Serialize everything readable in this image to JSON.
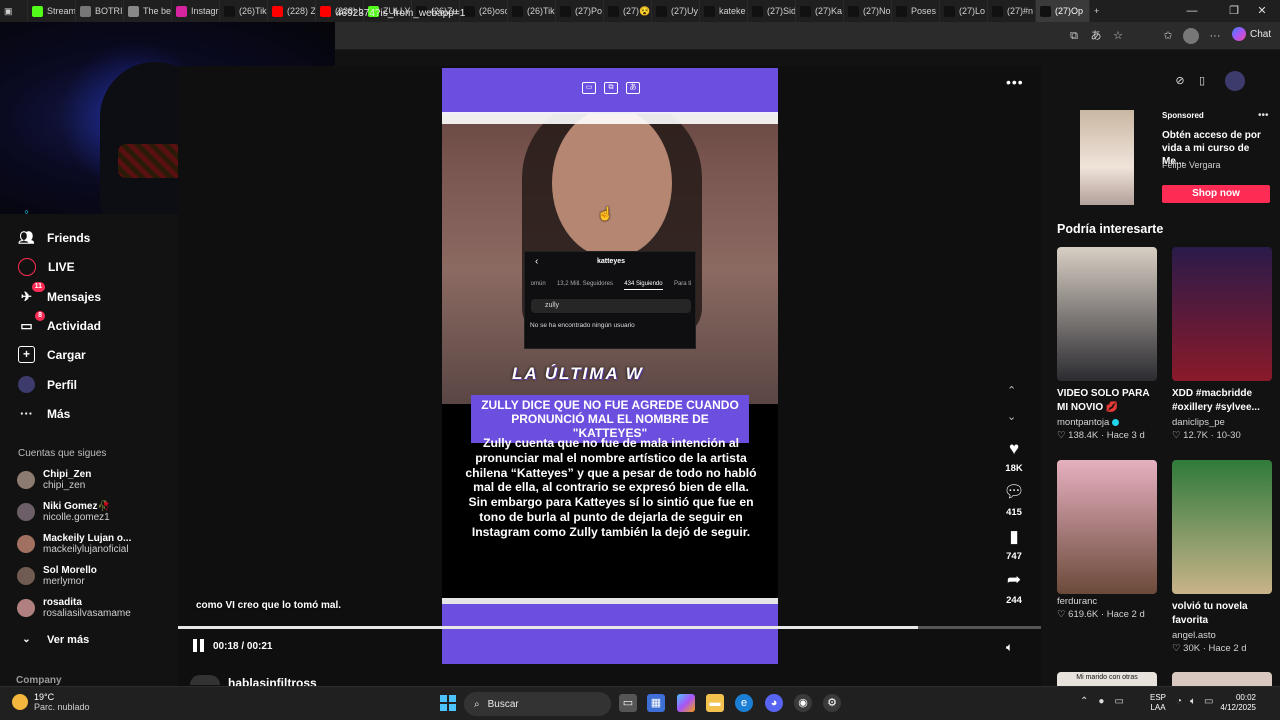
{
  "browser": {
    "tabs": [
      {
        "label": "Stream",
        "icon": "kick-icon",
        "color": "#53fc18"
      },
      {
        "label": "BOTRIX",
        "icon": "botrix-icon",
        "color": "#777777"
      },
      {
        "label": "The be",
        "icon": "diamond-icon",
        "color": "#888888"
      },
      {
        "label": "Instagr",
        "icon": "instagram-icon",
        "color": "#d6249f"
      },
      {
        "label": "(26)Tik",
        "icon": "tiktok-icon",
        "color": "#111111"
      },
      {
        "label": "(228) Z",
        "icon": "youtube-icon",
        "color": "#ff0000"
      },
      {
        "label": "(228) L",
        "icon": "youtube-icon",
        "color": "#ff0000"
      },
      {
        "label": "ZULLY",
        "icon": "kick-icon",
        "color": "#53fc18"
      },
      {
        "label": "(26)Zu",
        "icon": "tiktok-icon",
        "color": "#111111"
      },
      {
        "label": "(26)osc",
        "icon": "tiktok-icon",
        "color": "#111111"
      },
      {
        "label": "(26)Tik",
        "icon": "tiktok-icon",
        "color": "#111111"
      },
      {
        "label": "(27)Po",
        "icon": "tiktok-icon",
        "color": "#111111"
      },
      {
        "label": "(27)😵",
        "icon": "tiktok-icon",
        "color": "#111111"
      },
      {
        "label": "(27)Uy",
        "icon": "tiktok-icon",
        "color": "#111111"
      },
      {
        "label": "kateke",
        "icon": "tiktok-icon",
        "color": "#111111"
      },
      {
        "label": "(27)Sid",
        "icon": "tiktok-icon",
        "color": "#111111"
      },
      {
        "label": "(27)Ka",
        "icon": "tiktok-icon",
        "color": "#111111"
      },
      {
        "label": "(27)No",
        "icon": "tiktok-icon",
        "color": "#111111"
      },
      {
        "label": "Poses F",
        "icon": "tiktok-icon",
        "color": "#111111"
      },
      {
        "label": "(27)Lo",
        "icon": "tiktok-icon",
        "color": "#111111"
      },
      {
        "label": "(27)#n",
        "icon": "tiktok-icon",
        "color": "#111111"
      },
      {
        "label": "(27)Op",
        "icon": "tiktok-icon",
        "color": "#111111"
      }
    ],
    "url": "4692374?is_from_webapp=1",
    "chat_label": "Chat"
  },
  "nav": {
    "friends": "Friends",
    "live": "LIVE",
    "messages": "Mensajes",
    "messages_badge": "11",
    "activity": "Actividad",
    "activity_badge": "8",
    "upload": "Cargar",
    "profile": "Perfil",
    "more": "Más",
    "following_title": "Cuentas que sigues",
    "following": [
      {
        "name": "Chipi_Zen",
        "handle": "chipi_zen",
        "color": "#8c7b70"
      },
      {
        "name": "Niki Gomez🥀",
        "handle": "nicolle.gomez1",
        "color": "#6b5e66"
      },
      {
        "name": "Mackeily Lujan o...",
        "handle": "mackeilylujanoficial",
        "color": "#a07060"
      },
      {
        "name": "Sol Morello",
        "handle": "merlymor",
        "color": "#705a52"
      },
      {
        "name": "rosadita",
        "handle": "rosaliasilvasamame",
        "color": "#b08080"
      }
    ],
    "see_more": "Ver más",
    "company": "Company"
  },
  "video": {
    "insta_card": {
      "title": "katteyes",
      "tabs": [
        "omún",
        "13,2 Mill. Seguidores",
        "434 Siguiendo",
        "Para ti"
      ],
      "search_value": "zully",
      "empty_message": "No se ha encontrado ningún usuario"
    },
    "sticker_text": "LA ÚLTIMA W",
    "headline": "ZULLY DICE QUE NO FUE AGREDE CUANDO PRONUNCIÓ MAL EL NOMBRE DE \"KATTEYES\"",
    "body": "Zully cuenta que no fue de mala intención  al pronunciar mal el nombre artístico de la artista chilena “Katteyes” y que a pesar de todo no habló mal de ella, al contrario se expresó bien de ella. Sin embargo para Katteyes sí lo sintió que fue en tono de burla al punto de dejarla de seguir en Instagram como Zully también la dejó de seguir.",
    "caption": "como VI creo que lo tomó mal.",
    "time": "00:18 / 00:21",
    "progress": 0.857,
    "likes": "18K",
    "comments": "415",
    "saves": "747",
    "shares": "244",
    "next_author": "hablasinfiltross"
  },
  "sidebar_right": {
    "sponsored": "Sponsored",
    "ad_title": "Obtén acceso de por vida a mi curso de Me...",
    "ad_author": "Felipe Vergara",
    "shop_label": "Shop now",
    "interest_title": "Podría interesarte",
    "cards": [
      {
        "title": "VIDEO SOLO PARA MI NOVIO 💋",
        "author": "montpantoja",
        "verified": true,
        "likes": "138.4K",
        "ago": "Hace 3 d",
        "color1": "#d8cfc4",
        "color2": "#2b2b30"
      },
      {
        "title": "XDD #macbridde #oxillery #sylvee...",
        "author": "daniclips_pe",
        "verified": false,
        "likes": "12.7K",
        "ago": "10-30",
        "color1": "#2a1b4a",
        "color2": "#8a1a2a"
      },
      {
        "title": "",
        "author": "ferduranc",
        "verified": false,
        "likes": "619.6K",
        "ago": "Hace 2 d",
        "color1": "#e6b0c0",
        "color2": "#6b4a3a"
      },
      {
        "title": "volvió tu novela favorita",
        "author": "angel.asto",
        "verified": false,
        "likes": "30K",
        "ago": "Hace 2 d",
        "color1": "#2f7a3a",
        "color2": "#c9b38a"
      }
    ],
    "partial_card_text": "Mi marido con otras"
  },
  "taskbar": {
    "temp": "19°C",
    "weather": "Parc. nublado",
    "search": "Buscar",
    "lang1": "ESP",
    "lang2": "LAA",
    "time": "00:02",
    "date": "4/12/2025"
  },
  "colors": {
    "accent": "#fe2c55",
    "video_purple": "#6d4fe0"
  }
}
